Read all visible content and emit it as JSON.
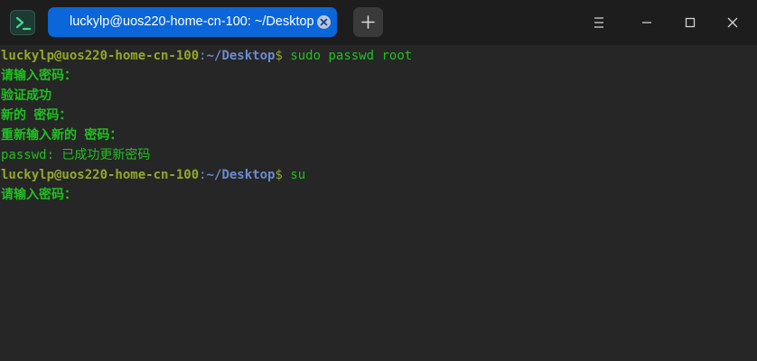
{
  "window": {
    "tab_title": "luckylp@uos220-home-cn-100: ~/Desktop"
  },
  "icons": {
    "app": "terminal-icon",
    "tab_close": "close-circle-icon",
    "new_tab": "plus-icon",
    "menu": "menu-icon",
    "minimize": "minimize-icon",
    "maximize": "maximize-icon",
    "close": "close-icon"
  },
  "colors": {
    "tab_active": "#0a66d9",
    "prompt_user": "#93a82a",
    "prompt_path": "#6a8bd1",
    "output_text": "#20c020",
    "background": "#262626"
  },
  "terminal": {
    "prompt1": {
      "user_host": "luckylp@uos220-home-cn-100",
      "colon": ":",
      "path": "~/Desktop",
      "dollar": "$",
      "command": " sudo passwd root"
    },
    "out1": "请输入密码：",
    "out2": "验证成功",
    "out3": "新的 密码：",
    "out4": "重新输入新的 密码：",
    "out5": "passwd: 已成功更新密码",
    "prompt2": {
      "user_host": "luckylp@uos220-home-cn-100",
      "colon": ":",
      "path": "~/Desktop",
      "dollar": "$",
      "command": " su"
    },
    "out6": "请输入密码："
  }
}
